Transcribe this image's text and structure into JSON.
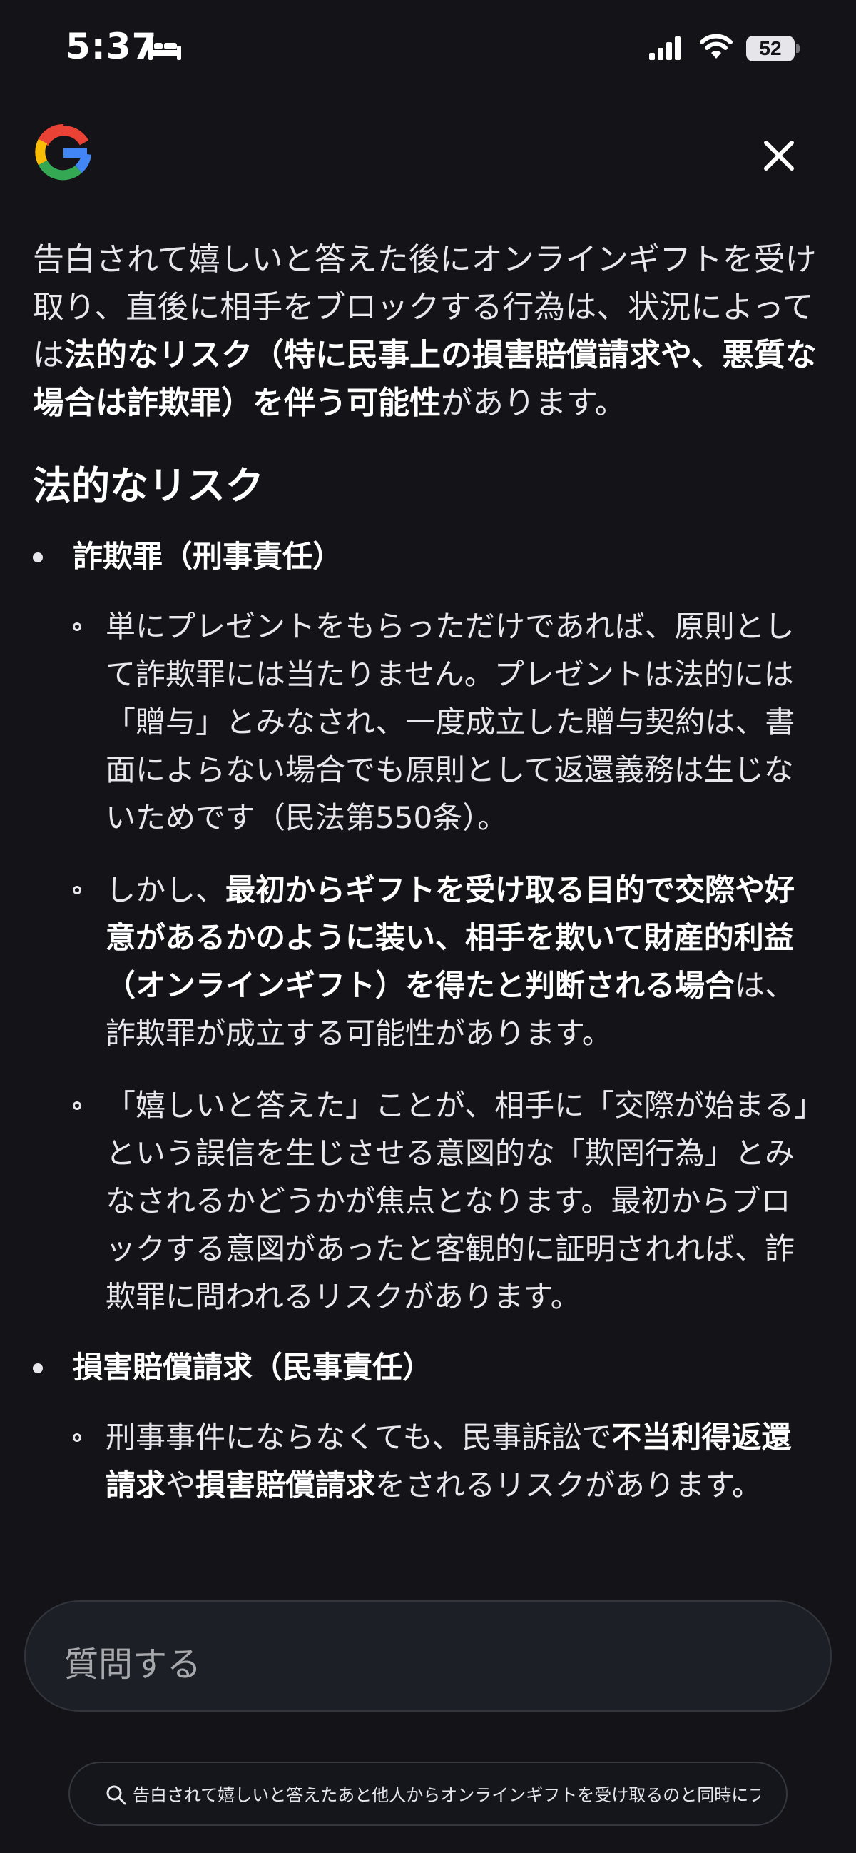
{
  "status_bar": {
    "time": "5:37",
    "battery": "52"
  },
  "header": {
    "logo_icon": "google-g-icon",
    "close_icon": "close-icon"
  },
  "answer": {
    "intro_1": "告白されて嬉しいと答えた後にオンラインギフトを受け取り、直後に相手をブロックする行為は、状況によっては",
    "intro_bold": "法的なリスク（特に民事上の損害賠償請求や、悪質な場合は詐欺罪）を伴う可能性",
    "intro_2": "があります。",
    "section_title": "法的なリスク",
    "bullets": [
      {
        "title": "詐欺罪（刑事責任）",
        "subs": [
          {
            "text": "単にプレゼントをもらっただけであれば、原則として詐欺罪には当たりません。プレゼントは法的には「贈与」とみなされ、一度成立した贈与契約は、書面によらない場合でも原則として返還義務は生じないためです（民法第550条）。"
          },
          {
            "pre": "しかし、",
            "bold": "最初からギフトを受け取る目的で交際や好意があるかのように装い、相手を欺いて財産的利益（オンラインギフト）を得たと判断される場合",
            "post": "は、詐欺罪が成立する可能性があります。"
          },
          {
            "text": "「嬉しいと答えた」ことが、相手に「交際が始まる」という誤信を生じさせる意図的な「欺罔行為」とみなされるかどうかが焦点となります。最初からブロックする意図があったと客観的に証明されれば、詐欺罪に問われるリスクがあります。"
          }
        ]
      },
      {
        "title": "損害賠償請求（民事責任）",
        "subs": [
          {
            "pre": "刑事事件にならなくても、民事訴訟で",
            "bold": "不当利得返還請求",
            "mid": "や",
            "bold2": "損害賠償請求",
            "post": "をされるリスクがあります。"
          }
        ]
      }
    ]
  },
  "input": {
    "placeholder": "質問する"
  },
  "suggestion": {
    "text": "告白されて嬉しいと答えたあと他人からオンラインギフトを受け取るのと同時にブ",
    "icon": "search-icon"
  }
}
